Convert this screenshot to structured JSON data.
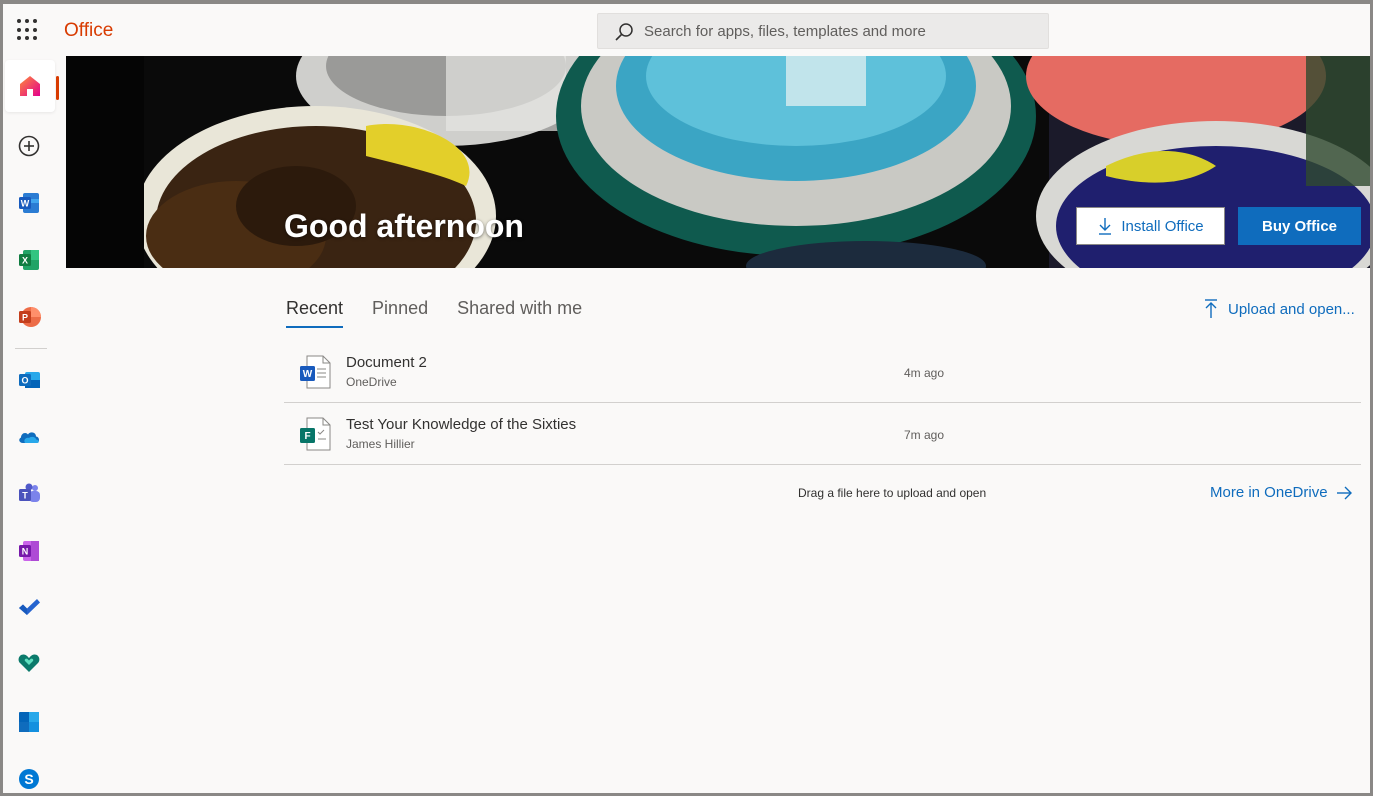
{
  "header": {
    "brand": "Office",
    "search": {
      "placeholder": "Search for apps, files, templates and more"
    }
  },
  "rail": {
    "items": [
      {
        "name": "home",
        "icon": "home-icon",
        "active": true
      },
      {
        "name": "create",
        "icon": "add-circle-icon"
      },
      {
        "name": "word",
        "icon": "word-icon",
        "letter": "W",
        "color": "#185abd"
      },
      {
        "name": "excel",
        "icon": "excel-icon",
        "letter": "X",
        "color": "#107c41"
      },
      {
        "name": "powerpoint",
        "icon": "powerpoint-icon",
        "letter": "P",
        "color": "#c43e1c"
      },
      {
        "name": "outlook",
        "icon": "outlook-icon",
        "letter": "O",
        "color": "#0f6cbd"
      },
      {
        "name": "onedrive",
        "icon": "onedrive-icon",
        "color": "#0f6cbd"
      },
      {
        "name": "teams",
        "icon": "teams-icon",
        "letter": "T",
        "color": "#5b5fc7"
      },
      {
        "name": "onenote",
        "icon": "onenote-icon",
        "letter": "N",
        "color": "#7719aa"
      },
      {
        "name": "todo",
        "icon": "todo-check-icon",
        "color": "#2564cf"
      },
      {
        "name": "family-safety",
        "icon": "family-safety-heart-icon",
        "color": "#0b7a6b"
      },
      {
        "name": "calendar",
        "icon": "calendar-icon",
        "color": "#0f6cbd"
      },
      {
        "name": "skype",
        "icon": "skype-icon",
        "letter": "S",
        "color": "#0078d4"
      }
    ]
  },
  "hero": {
    "greeting": "Good afternoon",
    "install_label": "Install Office",
    "buy_label": "Buy Office"
  },
  "tabs": [
    {
      "label": "Recent",
      "active": true
    },
    {
      "label": "Pinned"
    },
    {
      "label": "Shared with me"
    }
  ],
  "upload_label": "Upload and open...",
  "files": [
    {
      "name": "Document 2",
      "location": "OneDrive",
      "time": "4m ago",
      "type": "word"
    },
    {
      "name": "Test Your Knowledge of the Sixties",
      "location": "James Hillier",
      "time": "7m ago",
      "type": "forms"
    }
  ],
  "drag_hint": "Drag a file here to upload and open",
  "more_label": "More in OneDrive"
}
